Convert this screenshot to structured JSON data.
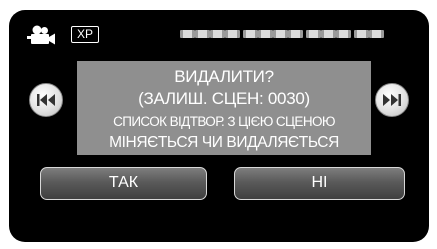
{
  "status_bar": {
    "mode_icon": "movie-camera-icon",
    "quality_badge": "XP"
  },
  "dialog": {
    "line1": "ВИДАЛИТИ?",
    "line2": "(ЗАЛИШ. СЦЕН: 0030)",
    "line3": "СПИСОК ВІДТВОР. З ЦІЄЮ СЦЕНОЮ",
    "line4": "МІНЯЄТЬСЯ ЧИ ВИДАЛЯЄТЬСЯ"
  },
  "navigation": {
    "prev_icon": "skip-previous-icon",
    "next_icon": "skip-next-icon"
  },
  "buttons": {
    "yes_label": "ТАК",
    "no_label": "НІ"
  },
  "colors": {
    "screen_background": "#000000",
    "message_box": "#8f8f8f",
    "text": "#ffffff"
  }
}
